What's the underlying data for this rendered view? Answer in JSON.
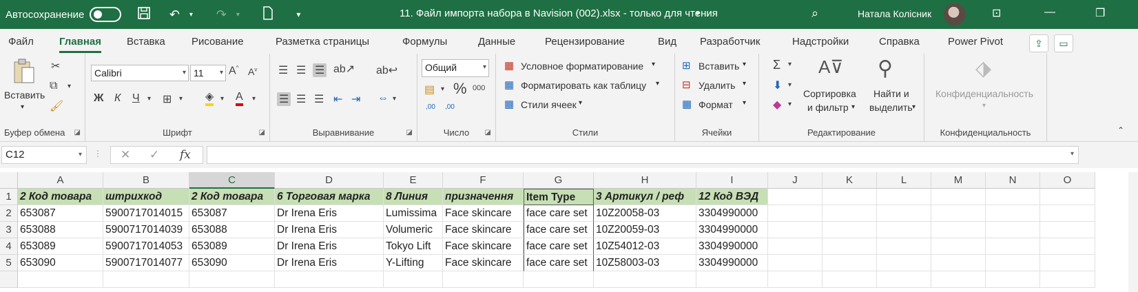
{
  "titlebar": {
    "autosave_label": "Автосохранение",
    "doc_title": "11. Файл импорта набора в Navision (002).xlsx  -  только для чтения",
    "user_name": "Натала Колісник"
  },
  "tabs": [
    "Файл",
    "Главная",
    "Вставка",
    "Рисование",
    "Разметка страницы",
    "Формулы",
    "Данные",
    "Рецензирование",
    "Вид",
    "Разработчик",
    "Надстройки",
    "Справка",
    "Power Pivot"
  ],
  "active_tab": "Главная",
  "ribbon": {
    "clipboard": {
      "paste": "Вставить",
      "label": "Буфер обмена"
    },
    "font": {
      "name": "Calibri",
      "size": "11",
      "bold": "Ж",
      "italic": "К",
      "underline": "Ч",
      "label": "Шрифт"
    },
    "alignment": {
      "label": "Выравнивание"
    },
    "number": {
      "format": "Общий",
      "label": "Число",
      "percent": "%",
      "thousands": "000",
      "inc_decimal": ",00",
      "dec_decimal": ",00"
    },
    "styles": {
      "conditional": "Условное форматирование",
      "as_table": "Форматировать как таблицу",
      "cell_styles": "Стили ячеек",
      "label": "Стили"
    },
    "cells": {
      "insert": "Вставить",
      "delete": "Удалить",
      "format": "Формат",
      "label": "Ячейки"
    },
    "editing": {
      "sort_1": "Сортировка",
      "sort_2": "и фильтр",
      "find_1": "Найти и",
      "find_2": "выделить",
      "label": "Редактирование"
    },
    "sensitivity": {
      "button": "Конфиденциальность",
      "label": "Конфиденциальность"
    }
  },
  "formula_bar": {
    "name_box": "C12",
    "cancel": "✕",
    "enter": "✓",
    "fx": "fx",
    "content": ""
  },
  "grid": {
    "columns": [
      "A",
      "B",
      "C",
      "D",
      "E",
      "F",
      "G",
      "H",
      "I",
      "J",
      "K",
      "L",
      "M",
      "N",
      "O"
    ],
    "row_numbers": [
      "1",
      "2",
      "3",
      "4",
      "5"
    ],
    "headers": [
      "2 Код товара",
      "штрихкод",
      "2 Код товара",
      "6 Торговая марка",
      "8 Линия",
      "призначення",
      "Item Type",
      "3 Артикул / реф",
      "12 Код ВЭД"
    ],
    "rows": [
      [
        "653087",
        "5900717014015",
        "653087",
        "Dr Irena Eris",
        "Lumissima",
        "Face skincare",
        "face care set",
        "10Z20058-03",
        "3304990000"
      ],
      [
        "653088",
        "5900717014039",
        "653088",
        "Dr Irena Eris",
        "Volumeric",
        "Face skincare",
        "face care set",
        "10Z20059-03",
        "3304990000"
      ],
      [
        "653089",
        "5900717014053",
        "653089",
        "Dr Irena Eris",
        "Tokyo Lift",
        "Face skincare",
        "face care set",
        "10Z54012-03",
        "3304990000"
      ],
      [
        "653090",
        "5900717014077",
        "653090",
        "Dr Irena Eris",
        "Y-Lifting",
        "Face skincare",
        "face care set",
        "10Z58003-03",
        "3304990000"
      ]
    ],
    "selected_column": "C",
    "header_fill": "#c6dfb4"
  },
  "colors": {
    "accent": "#1e6f43"
  }
}
